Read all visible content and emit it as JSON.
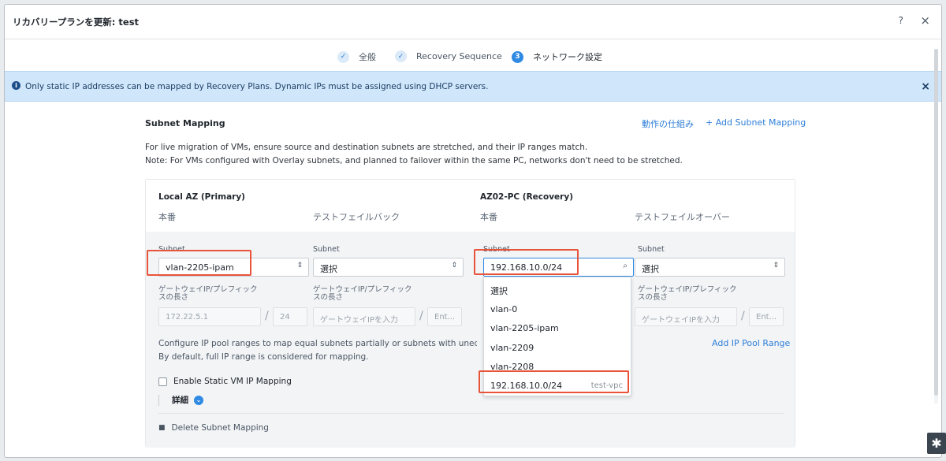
{
  "window": {
    "title": "リカバリープランを更新: test",
    "help": "?",
    "close": "×"
  },
  "steps": [
    {
      "label": "全般",
      "marker": "✓"
    },
    {
      "label": "Recovery Sequence",
      "marker": "✓"
    },
    {
      "label": "ネットワーク設定",
      "marker": "3"
    }
  ],
  "banner": {
    "icon": "info-icon",
    "text": "Only static IP addresses can be mapped by Recovery Plans. Dynamic IPs must be assigned using DHCP servers.",
    "close": "×"
  },
  "subnet_mapping": {
    "title": "Subnet Mapping",
    "how_it_works": "動作の仕組み",
    "add_mapping": "+ Add Subnet Mapping",
    "desc1": "For live migration of VMs, ensure source and destination subnets are stretched, and their IP ranges match.",
    "desc2": "Note: For VMs configured with Overlay subnets, and planned to failover within the same PC, networks don't need to be stretched."
  },
  "local": {
    "title": "Local AZ (Primary)",
    "prod": "本番",
    "test": "テストフェイルバック"
  },
  "recovery": {
    "title": "AZ02-PC (Recovery)",
    "prod": "本番",
    "test": "テストフェイルオーバー"
  },
  "fields": {
    "subnet_label": "Subnet",
    "gateway_label_1": "ゲートウェイIP/プレフィック",
    "gateway_label_2": "スの長さ",
    "col1": {
      "subnet": "vlan-2205-ipam",
      "gateway": "172.22.5.1",
      "prefix": "24"
    },
    "col2": {
      "subnet": "選択",
      "gateway_ph": "ゲートウェイIPを入力",
      "prefix_ph": "Ent..."
    },
    "col3": {
      "subnet": "192.168.10.0/24"
    },
    "col4": {
      "subnet": "選択",
      "gateway_ph": "ゲートウェイIPを入力",
      "prefix_ph": "Ent..."
    }
  },
  "pool": {
    "line1": "Configure IP pool ranges to map equal subnets partially or subnets with unequal prefixes.",
    "line2": "By default, full IP range is considered for mapping.",
    "add_range": "Add IP Pool Range"
  },
  "static_vm": {
    "label": "Enable Static VM IP Mapping",
    "checked": false
  },
  "details": {
    "label": "詳細"
  },
  "delete_mapping": "Delete Subnet Mapping",
  "dropdown": {
    "items": [
      {
        "label": "選択",
        "sub": ""
      },
      {
        "label": "vlan-0",
        "sub": ""
      },
      {
        "label": "vlan-2205-ipam",
        "sub": ""
      },
      {
        "label": "vlan-2209",
        "sub": ""
      },
      {
        "label": "vlan-2208",
        "sub": ""
      },
      {
        "label": "192.168.10.0/24",
        "sub": "test-vpc"
      }
    ]
  },
  "colors": {
    "accent": "#2f8ae4",
    "highlight": "#e8543a",
    "banner_bg": "#cfe6fb"
  }
}
